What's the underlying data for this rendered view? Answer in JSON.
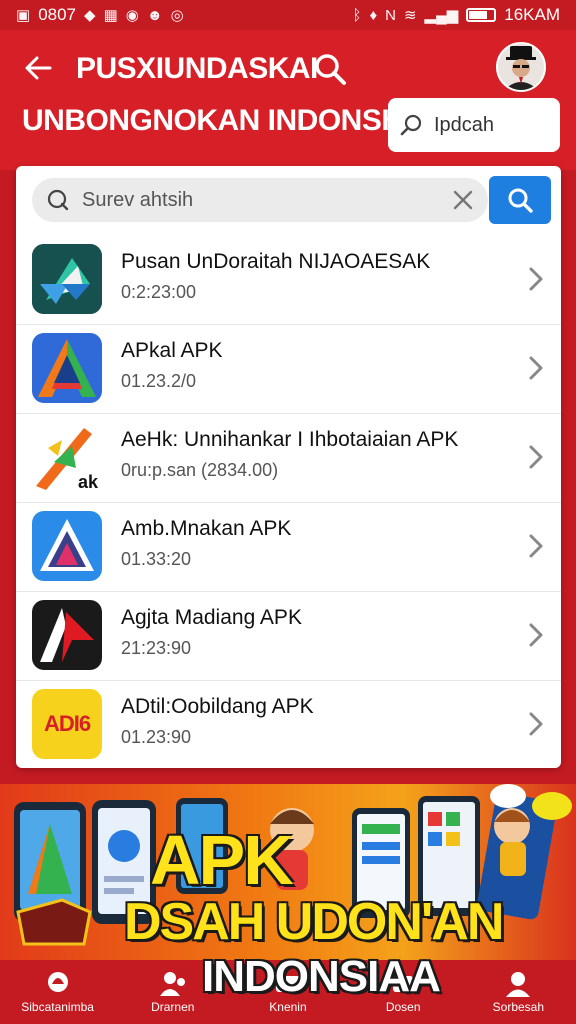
{
  "status_bar": {
    "left_text": "0807",
    "right_text": "16KAM",
    "icons": [
      "image-icon",
      "app-icon",
      "gallery-icon",
      "video-icon",
      "face-icon",
      "location-icon",
      "bluetooth-icon",
      "mute-icon",
      "nfc-icon",
      "wifi-icon",
      "signal-icon",
      "battery-icon"
    ]
  },
  "header": {
    "title": "PUSXIUNDASKAI",
    "subtitle": "UNBONGNOKAN INDONSHI",
    "search_box_value": "Ipdcah",
    "colors": {
      "primary": "#d61f26",
      "status": "#c41a22"
    }
  },
  "search": {
    "placeholder": "Surev ahtsih",
    "button_color": "#1e7fe0"
  },
  "apps": [
    {
      "name": "Pusan UnDoraitah NIJAOAESAK",
      "meta": "0:2:23:00",
      "icon": "teal-arrow-logo"
    },
    {
      "name": "APkal APK",
      "meta": "01.23.2/0",
      "icon": "blue-green-a-logo"
    },
    {
      "name": "AeHk: Unnihankar I Ihbotaiaian APK",
      "meta": "0ru:p.san (2834.00)",
      "icon": "orange-green-arrow-logo"
    },
    {
      "name": "Amb.Mnakan APK",
      "meta": "01.33:20",
      "icon": "blue-triangle-logo"
    },
    {
      "name": "Agjta Madiang APK",
      "meta": "21:23:90",
      "icon": "black-red-a-logo"
    },
    {
      "name": "ADtil:Oobildang APK",
      "meta": "01.23:90",
      "icon": "yellow-adi6-logo"
    }
  ],
  "app6_icon_text": "ADI6",
  "banner": {
    "line1": "APK",
    "line2": "DSAH UDON'AN",
    "line3": "INDONSIAA"
  },
  "bottom_nav": [
    {
      "label": "Sibcatanimba",
      "icon": "home-icon"
    },
    {
      "label": "Drarnen",
      "icon": "people-icon"
    },
    {
      "label": "Knenin",
      "icon": "video-icon"
    },
    {
      "label": "Dosen",
      "icon": "person-icon"
    },
    {
      "label": "Sorbesah",
      "icon": "profile-icon"
    }
  ]
}
